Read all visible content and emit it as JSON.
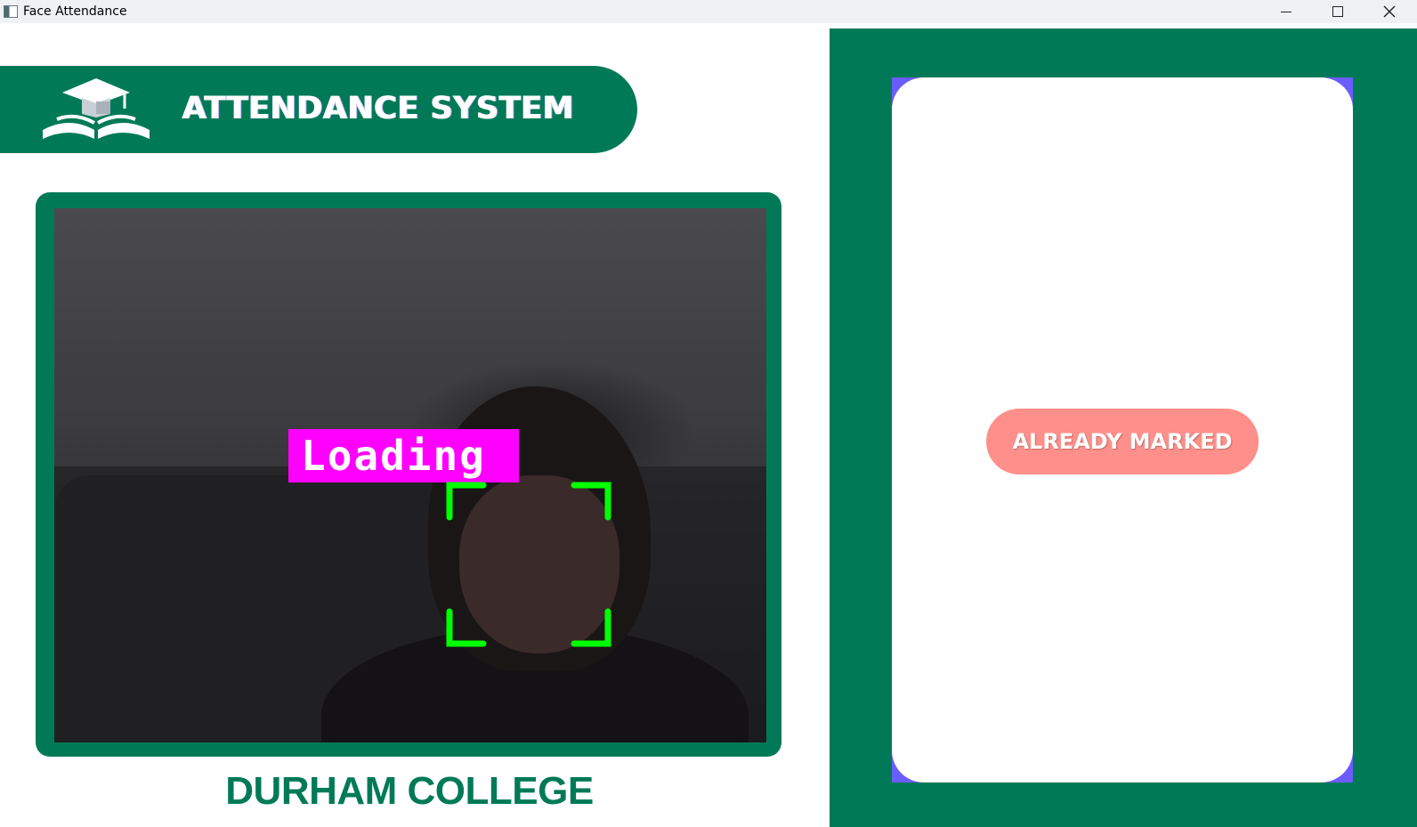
{
  "window": {
    "title": "Face Attendance"
  },
  "header": {
    "title": "ATTENDANCE SYSTEM",
    "logo_icon": "graduation-cap-book-icon"
  },
  "camera": {
    "status_label": "Loading",
    "status_label_color": "#ff00ff",
    "face_box_color": "#00ff00"
  },
  "footer": {
    "college_name": "DURHAM COLLEGE"
  },
  "side_panel": {
    "status_text": "ALREADY MARKED",
    "status_color": "#ff8f8a"
  },
  "colors": {
    "brand_green": "#007a56",
    "card_backing": "#6b5cff",
    "background": "#ffffff"
  }
}
